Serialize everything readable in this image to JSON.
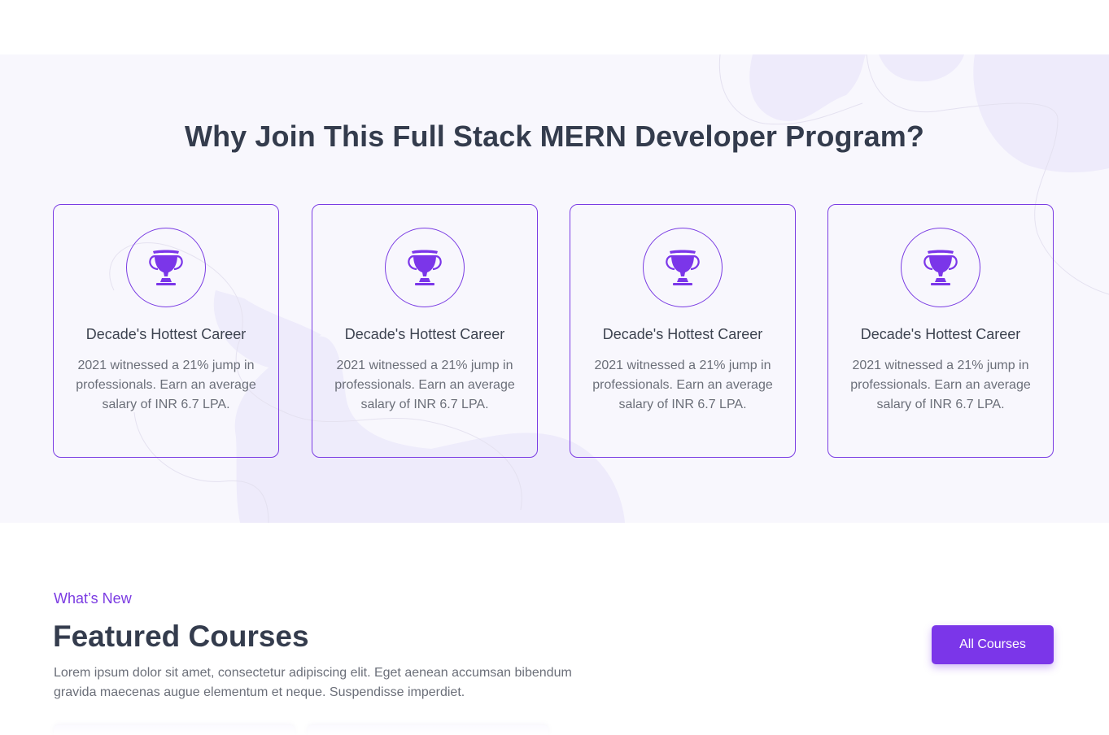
{
  "why_section": {
    "title": "Why Join This Full Stack MERN Developer Program?",
    "cards": [
      {
        "icon": "trophy-icon",
        "title": "Decade's Hottest Career",
        "text": "2021 witnessed a 21% jump in professionals. Earn an average salary of INR 6.7 LPA."
      },
      {
        "icon": "trophy-icon",
        "title": "Decade's Hottest Career",
        "text": "2021 witnessed a 21% jump in professionals. Earn an average salary of INR 6.7 LPA."
      },
      {
        "icon": "trophy-icon",
        "title": "Decade's Hottest Career",
        "text": "2021 witnessed a 21% jump in professionals. Earn an average salary of INR 6.7 LPA."
      },
      {
        "icon": "trophy-icon",
        "title": "Decade's Hottest Career",
        "text": "2021 witnessed a 21% jump in professionals. Earn an average salary of INR 6.7 LPA."
      }
    ]
  },
  "featured": {
    "eyebrow": "What’s New",
    "title": "Featured Courses",
    "description": "Lorem ipsum dolor sit amet, consectetur adipiscing elit. Eget aenean accumsan bibendum gravida maecenas augue elementum et neque. Suspendisse imperdiet.",
    "button_label": "All Courses"
  },
  "colors": {
    "accent": "#7b36e9",
    "section_bg": "#f8f7fd",
    "heading": "#343c4d",
    "body_text": "#6b6f79"
  }
}
